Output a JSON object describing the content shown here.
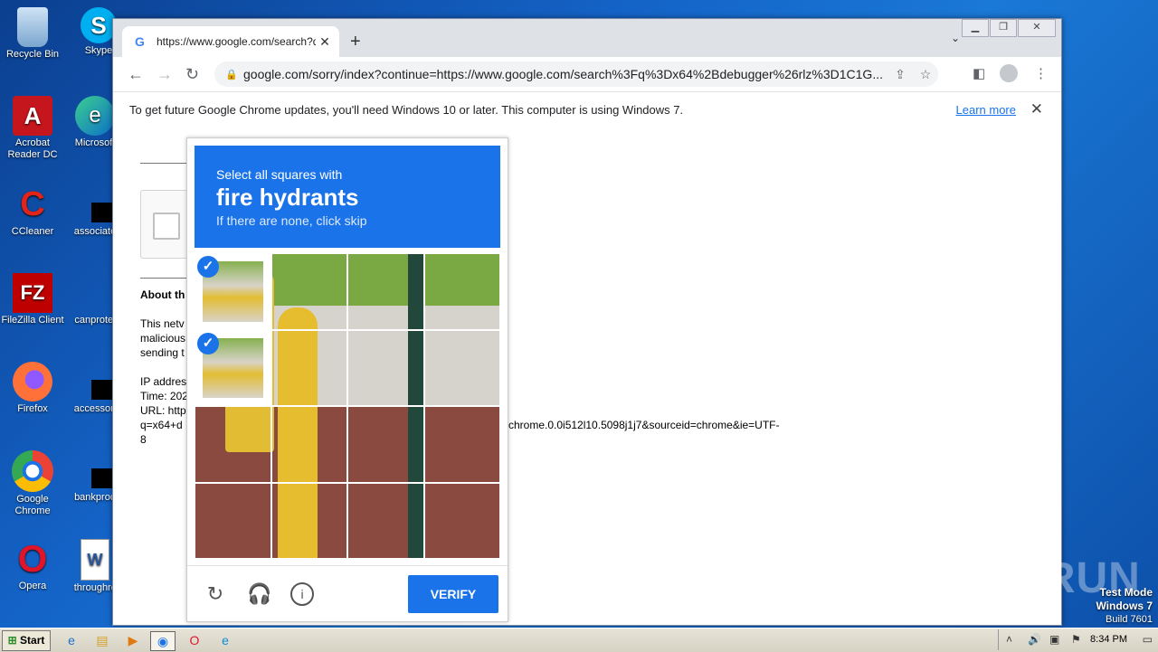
{
  "desktop": {
    "icons": [
      {
        "label": "Recycle Bin",
        "glyph": "🗑"
      },
      {
        "label": "Skype",
        "glyph": "S"
      },
      {
        "label": "Acrobat Reader DC",
        "glyph": "A"
      },
      {
        "label": "Microsoft",
        "glyph": "e"
      },
      {
        "label": "CCleaner",
        "glyph": "C"
      },
      {
        "label": "associate",
        "glyph": ""
      },
      {
        "label": "FileZilla Client",
        "glyph": "FZ"
      },
      {
        "label": "canprotei",
        "glyph": ""
      },
      {
        "label": "Firefox",
        "glyph": "🦊"
      },
      {
        "label": "accessori",
        "glyph": ""
      },
      {
        "label": "Google Chrome",
        "glyph": "◉"
      },
      {
        "label": "bankproo",
        "glyph": ""
      },
      {
        "label": "Opera",
        "glyph": "O"
      },
      {
        "label": "throughrc",
        "glyph": "W"
      }
    ]
  },
  "browser": {
    "tab_title": "https://www.google.com/search?q=",
    "tab_favicon": "G",
    "url": "google.com/sorry/index?continue=https://www.google.com/search%3Fq%3Dx64%2Bdebugger%26rlz%3D1C1G...",
    "infobar_message": "To get future Google Chrome updates, you'll need Windows 10 or later. This computer is using Windows 7.",
    "infobar_link": "Learn more"
  },
  "page": {
    "about_heading": "About th",
    "para1": "This netv",
    "para2": "malicious",
    "para3": "sending t",
    "ip_label": "IP addres",
    "time_label": "Time: 202",
    "url_label": "URL: http",
    "url_line2_start": "q=x64+d",
    "url_line2_end": "chrome.0.0i512l10.5098j1j7&sourceid=chrome&ie=UTF-",
    "url_line3": "8"
  },
  "captcha": {
    "line1": "Select all squares with",
    "line2": "fire hydrants",
    "line3": "If there are none, click skip",
    "verify_label": "VERIFY",
    "selected_cells": [
      "0,0",
      "1,0"
    ]
  },
  "taskbar": {
    "start_label": "Start",
    "clock": "8:34 PM"
  },
  "overlay": {
    "watermark": "ANY RUN",
    "testmode_line1": "Test Mode",
    "testmode_line2": "Windows 7",
    "testmode_line3": "Build 7601"
  }
}
